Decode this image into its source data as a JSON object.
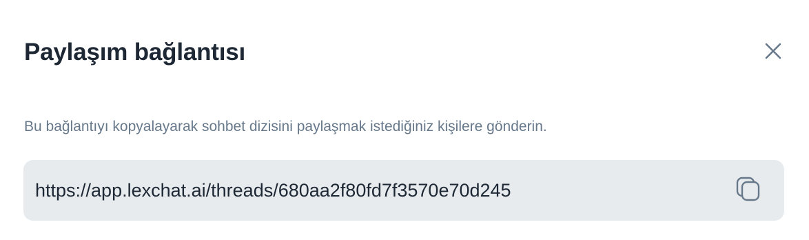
{
  "dialog": {
    "title": "Paylaşım bağlantısı",
    "description": "Bu bağlantıyı kopyalayarak sohbet dizisini paylaşmak istediğiniz kişilere gönderin.",
    "share_url": "https://app.lexchat.ai/threads/680aa2f80fd7f3570e70d245",
    "icons": {
      "close": "close-icon",
      "copy": "copy-icon"
    },
    "colors": {
      "title": "#1e2835",
      "muted_text": "#66788a",
      "link_box_bg": "#e8ebee",
      "icon": "#66788a"
    }
  }
}
